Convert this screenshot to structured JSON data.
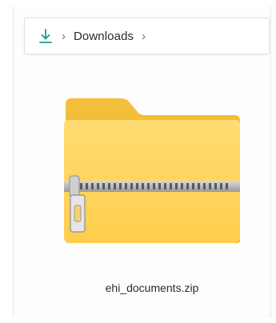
{
  "breadcrumb": {
    "icon": "download-icon",
    "items": [
      "Downloads"
    ]
  },
  "file": {
    "name": "ehi_documents.zip",
    "icon": "zip-folder-icon"
  },
  "colors": {
    "accent": "#1e9c86",
    "folder_light": "#ffd966",
    "folder_dark": "#f2b52b"
  }
}
